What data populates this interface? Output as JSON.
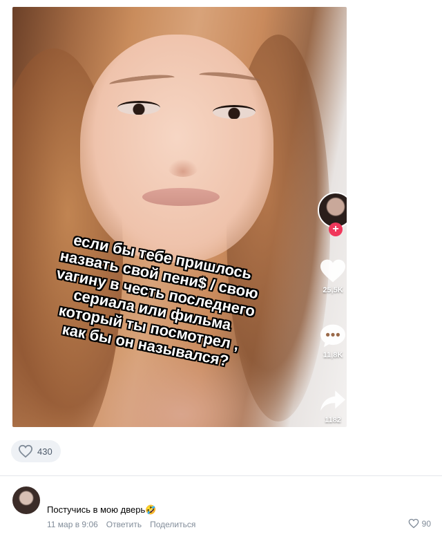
{
  "video": {
    "caption_lines": [
      "если бы тебе пришлось",
      "назвать свой пени$ / свою",
      "vагину в честь последнего",
      "сериала или фильма",
      "который ты посмотрел ,",
      "как бы он назывался?"
    ],
    "rail": {
      "likes": "25,5K",
      "comments": "11,8K",
      "shares": "1182",
      "follow_icon": "plus-icon",
      "accent_color": "#f0375b"
    }
  },
  "post": {
    "likes_count": "430"
  },
  "comment": {
    "text": "Постучись в мою дверь🤣",
    "date": "11 мар в 9:06",
    "reply_label": "Ответить",
    "share_label": "Поделиться",
    "likes_count": "90"
  },
  "colors": {
    "meta_gray": "#818c99",
    "pill_bg": "#eef1f5"
  }
}
